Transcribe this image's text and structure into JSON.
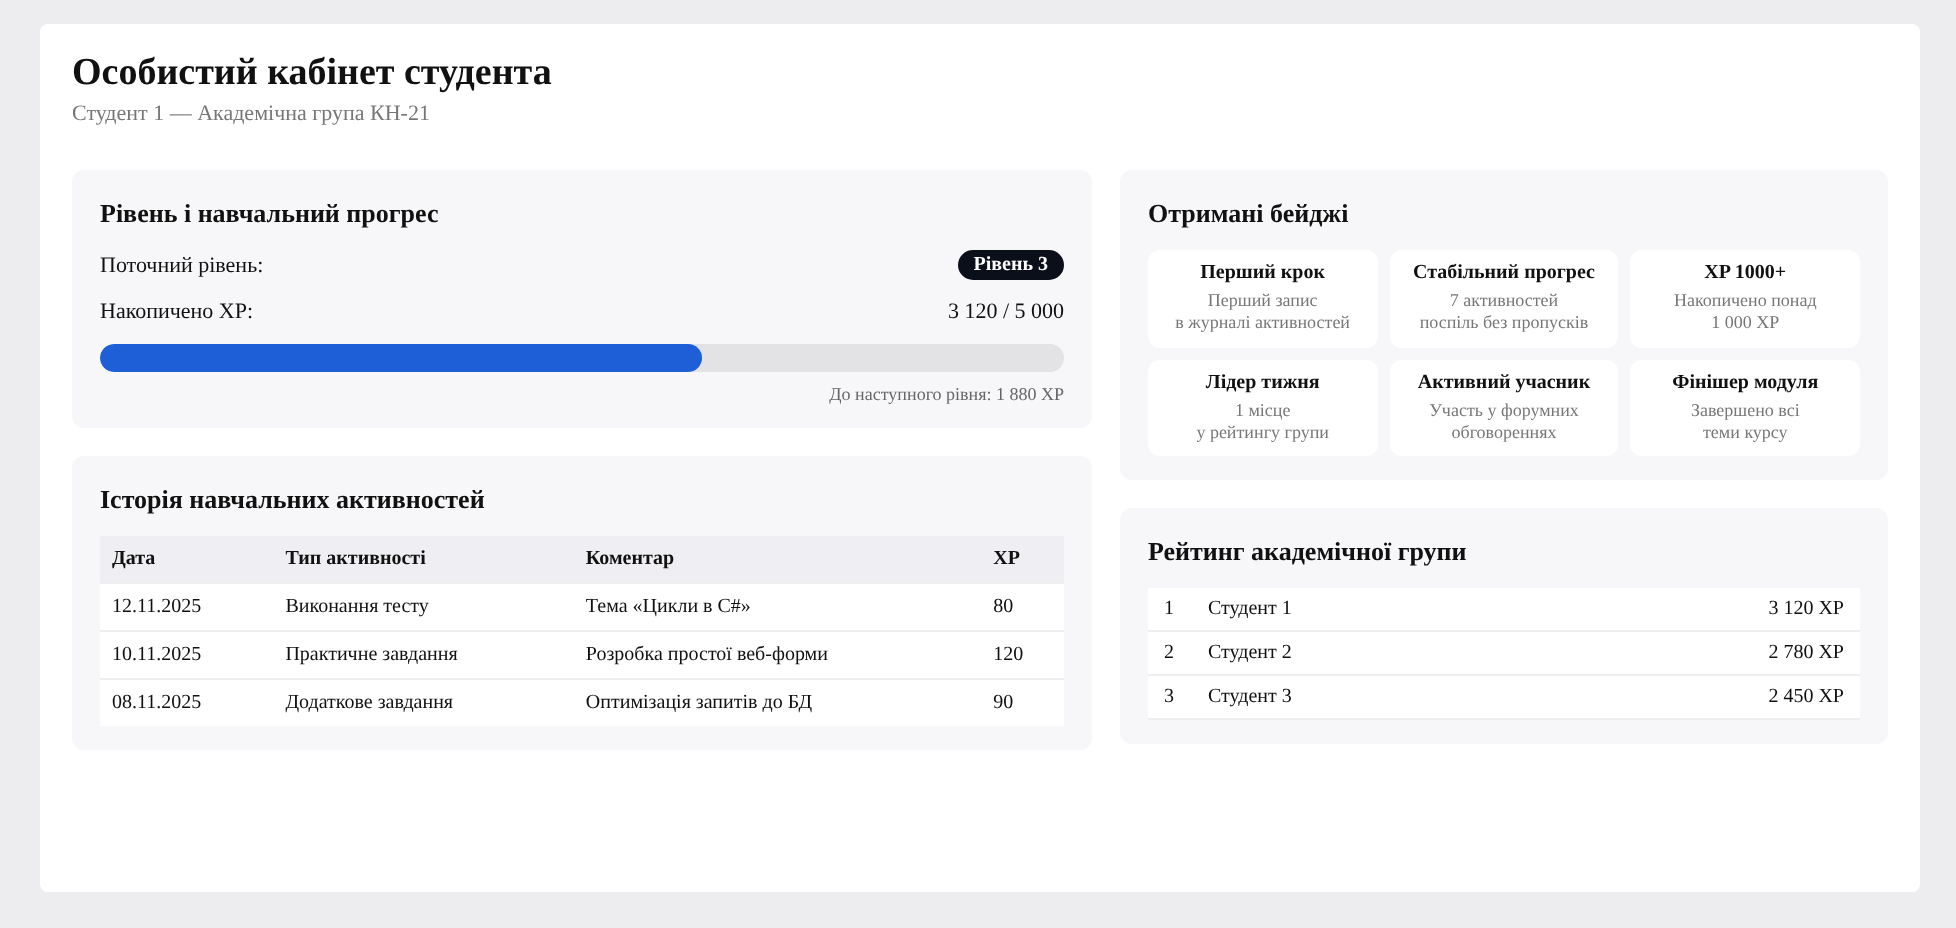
{
  "header": {
    "title": "Особистий кабінет студента",
    "subtitle": "Студент 1 — Академічна група КН-21"
  },
  "progress": {
    "title": "Рівень і навчальний прогрес",
    "level_label": "Поточний рівень:",
    "level_badge": "Рівень 3",
    "xp_label": "Накопичено XP:",
    "xp_value": "3 120 / 5 000",
    "level": 0.624,
    "next_note": "До наступного рівня: 1 880 XP"
  },
  "history": {
    "title": "Історія навчальних активностей",
    "columns": [
      "Дата",
      "Тип активності",
      "Коментар",
      "XP"
    ],
    "rows": [
      [
        "12.11.2025",
        "Виконання тесту",
        "Тема «Цикли в C#»",
        "80"
      ],
      [
        "10.11.2025",
        "Практичне завдання",
        "Розробка простої веб-форми",
        "120"
      ],
      [
        "08.11.2025",
        "Додаткове завдання",
        "Оптимізація запитів до БД",
        "90"
      ]
    ]
  },
  "badges": {
    "title": "Отримані бейджі",
    "items": [
      {
        "name": "Перший крок",
        "description": "Перший запис\nв журналі активностей"
      },
      {
        "name": "Стабільний прогрес",
        "description": "7 активностей\nпоспіль без пропусків"
      },
      {
        "name": "XP 1000+",
        "description": "Накопичено понад\n1 000 XP"
      },
      {
        "name": "Лідер тижня",
        "description": "1 місце\nу рейтингу групи"
      },
      {
        "name": "Активний учасник",
        "description": "Участь у форумних\nобговореннях"
      },
      {
        "name": "Фінішер модуля",
        "description": "Завершено всі\nтеми курсу"
      }
    ]
  },
  "ranking": {
    "title": "Рейтинг академічної групи",
    "rows": [
      {
        "place": "1",
        "name": "Студент 1",
        "xp": "3 120 XP"
      },
      {
        "place": "2",
        "name": "Студент 2",
        "xp": "2 780 XP"
      },
      {
        "place": "3",
        "name": "Студент 3",
        "xp": "2 450 XP"
      }
    ]
  }
}
